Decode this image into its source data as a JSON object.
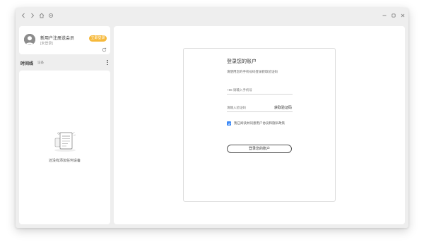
{
  "titlebar": {
    "back_icon": "chevron-left-icon",
    "forward_icon": "chevron-right-icon",
    "home_icon": "home-icon",
    "settings_icon": "gear-icon",
    "minimize_icon": "minimize-icon",
    "maximize_icon": "maximize-icon",
    "close_icon": "close-icon"
  },
  "sidebar": {
    "user": {
      "name": "新用户注册送会员",
      "status": "[未登录]",
      "badge": "立即登录",
      "badge_color": "#f6b93b"
    },
    "section": {
      "title": "时间线",
      "subtitle": "设备"
    },
    "empty_text": "还没有添加任何设备"
  },
  "login": {
    "title": "登录您的账户",
    "description": "请使用您的手机号码登录获取验证码",
    "phone_placeholder": "+86 请输入手机号",
    "code_placeholder": "请输入验证码",
    "get_code": "获取验证码",
    "agreement": "我已阅读并同意用户协议和隐私政策",
    "button": "登录您的账户",
    "accent_color": "#3d8af7"
  }
}
